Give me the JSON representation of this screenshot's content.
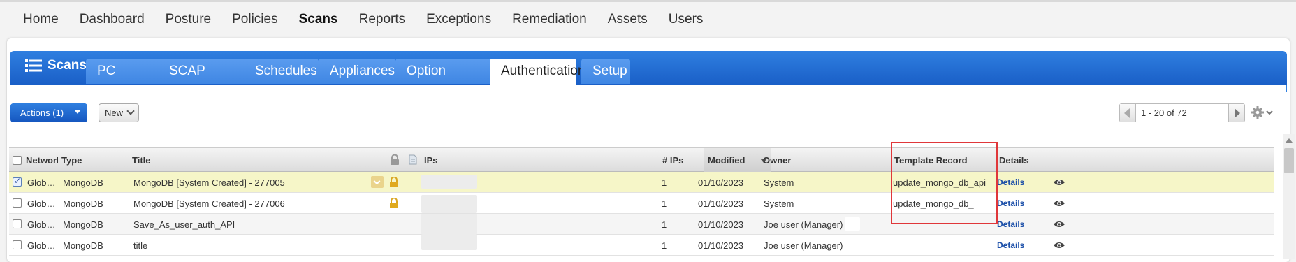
{
  "topnav": [
    "Home",
    "Dashboard",
    "Posture",
    "Policies",
    "Scans",
    "Reports",
    "Exceptions",
    "Remediation",
    "Assets",
    "Users"
  ],
  "module": {
    "title": "Scans",
    "tabs": [
      "PC Scans",
      "SCAP Scans",
      "Schedules",
      "Appliances",
      "Option Profiles",
      "Authentication",
      "Setup"
    ],
    "active_tab": "Authentication"
  },
  "toolbar": {
    "actions_label": "Actions (1)",
    "new_label": "New",
    "pager_text": "1 - 20 of 72"
  },
  "columns": {
    "network": "Network",
    "type": "Type",
    "title": "Title",
    "ips": "IPs",
    "num_ips": "# IPs",
    "modified": "Modified",
    "owner": "Owner",
    "template_record": "Template Record",
    "details": "Details"
  },
  "rows": [
    {
      "network": "Glob…",
      "type": "MongoDB",
      "title": "MongoDB [System Created] - 277005",
      "num_ips": "1",
      "modified": "01/10/2023",
      "owner": "System",
      "template": "update_mongo_db_api",
      "details": "Details"
    },
    {
      "network": "Glob…",
      "type": "MongoDB",
      "title": "MongoDB [System Created] - 277006",
      "num_ips": "1",
      "modified": "01/10/2023",
      "owner": "System",
      "template": "update_mongo_db_",
      "details": "Details"
    },
    {
      "network": "Glob…",
      "type": "MongoDB",
      "title": "Save_As_user_auth_API",
      "num_ips": "1",
      "modified": "01/10/2023",
      "owner": "Joe user (Manager)",
      "template": "",
      "details": "Details"
    },
    {
      "network": "Glob…",
      "type": "MongoDB",
      "title": "title",
      "num_ips": "1",
      "modified": "01/10/2023",
      "owner": "Joe user (Manager)",
      "template": "",
      "details": "Details"
    }
  ],
  "colors": {
    "accent_blue": "#1a5fc7",
    "highlight_box": "#e0373a",
    "selected_row": "#f6f6c8"
  }
}
